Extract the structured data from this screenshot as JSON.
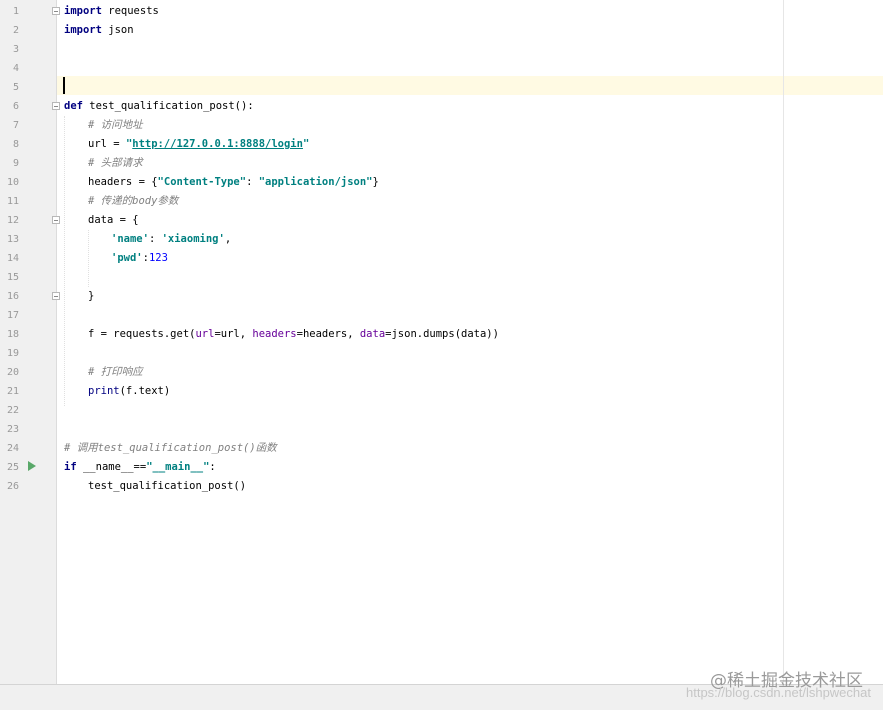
{
  "gutter": {
    "line_numbers": [
      "1",
      "2",
      "3",
      "4",
      "5",
      "6",
      "7",
      "8",
      "9",
      "10",
      "11",
      "12",
      "13",
      "14",
      "15",
      "16",
      "17",
      "18",
      "19",
      "20",
      "21",
      "22",
      "23",
      "24",
      "25",
      "26"
    ]
  },
  "code": {
    "l1": {
      "kw": "import",
      "rest": " requests"
    },
    "l2": {
      "kw": "import",
      "rest": " json"
    },
    "l6": {
      "kw": "def",
      "rest": " test_qualification_post():"
    },
    "l7": {
      "comment": "# 访问地址"
    },
    "l8": {
      "a": "url = ",
      "q1": "\"",
      "link": "http://127.0.0.1:8888/login",
      "q2": "\""
    },
    "l9": {
      "comment": "# 头部请求"
    },
    "l10": {
      "a": "headers = {",
      "s1": "\"Content-Type\"",
      "b": ": ",
      "s2": "\"application/json\"",
      "c": "}"
    },
    "l11": {
      "comment": "# 传递的body参数"
    },
    "l12": {
      "a": "data = {"
    },
    "l13": {
      "s1": "'name'",
      "b": ": ",
      "s2": "'xiaoming'",
      "c": ","
    },
    "l14": {
      "s1": "'pwd'",
      "b": ":",
      "num": "123"
    },
    "l16": {
      "a": "}"
    },
    "l18": {
      "a": "f = requests.get(",
      "p1": "url",
      "b": "=url, ",
      "p2": "headers",
      "c": "=headers, ",
      "p3": "data",
      "d": "=json.dumps(data))"
    },
    "l20": {
      "comment": "# 打印响应"
    },
    "l21": {
      "builtin": "print",
      "rest": "(f.text)"
    },
    "l24": {
      "comment": "# 调用test_qualification_post()函数"
    },
    "l25": {
      "kw": "if",
      "a": " __name__==",
      "s": "\"__main__\"",
      "b": ":"
    },
    "l26": {
      "a": "test_qualification_post()"
    }
  },
  "watermark": {
    "logo": "@稀土掘金技术社区",
    "url": "https://blog.csdn.net/lshpwechat"
  },
  "colors": {
    "keyword": "#000080",
    "string": "#008080",
    "comment": "#808080",
    "param": "#660099",
    "number": "#0000ff",
    "run_icon": "#59a869",
    "caret_line": "#fffae3"
  },
  "icons": {
    "run": "run-triangle-icon",
    "fold": "fold-toggle-icon"
  }
}
